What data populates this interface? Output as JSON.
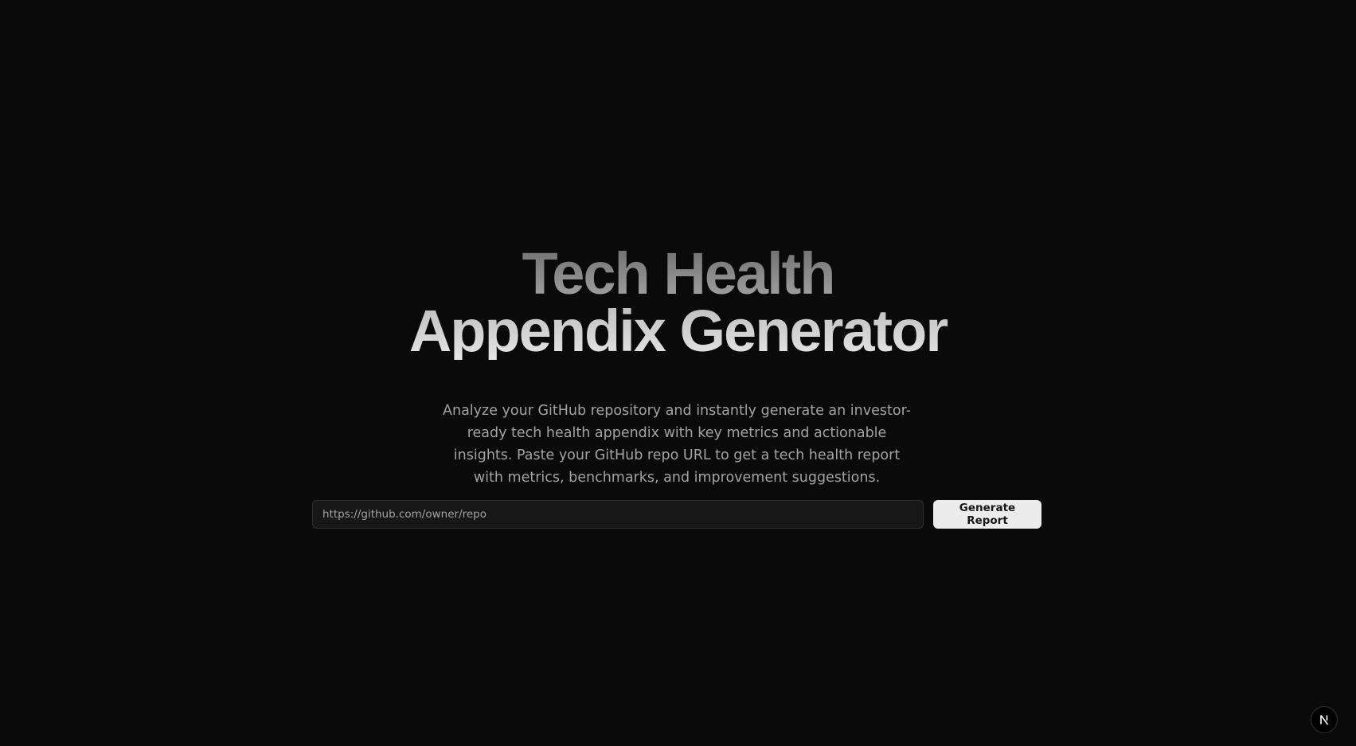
{
  "hero": {
    "title_line_1": "Tech Health",
    "title_line_2": "Appendix Generator",
    "subtitle": "Analyze your GitHub repository and instantly generate an investor-ready tech health appendix with key metrics and actionable insights. Paste your GitHub repo URL to get a tech health report with metrics, benchmarks, and improvement suggestions."
  },
  "form": {
    "repo_url_placeholder": "https://github.com/owner/repo",
    "repo_url_value": "",
    "submit_label": "Generate Report"
  },
  "badge": {
    "icon": "nextjs-logo-icon"
  },
  "colors": {
    "background": "#0a0a0a",
    "button_bg": "#ececec",
    "button_text": "#171717",
    "input_bg": "#171717",
    "subtitle_text": "#a3a3a3"
  }
}
